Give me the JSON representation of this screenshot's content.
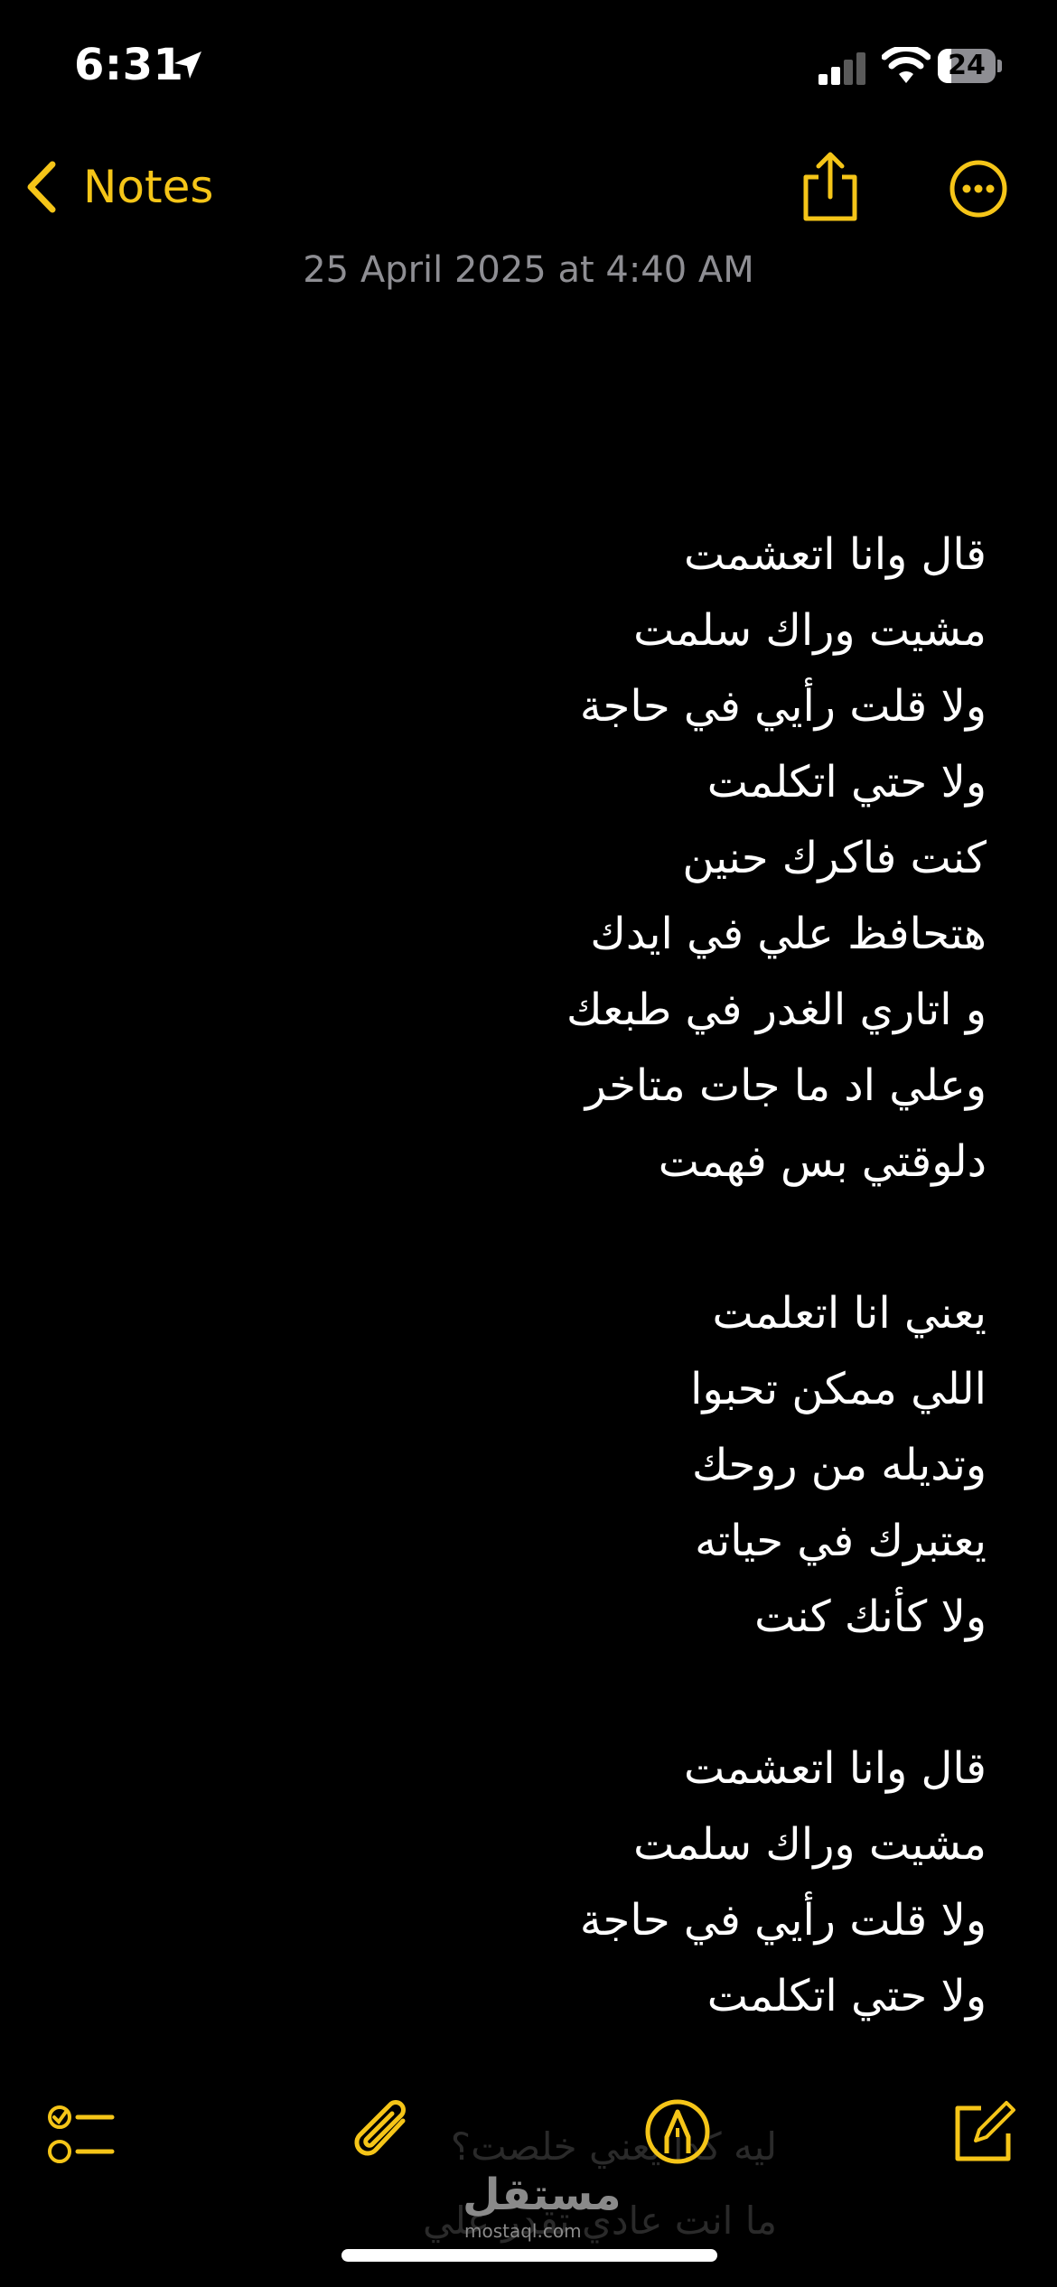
{
  "status_bar": {
    "time": "6:31",
    "battery": "24",
    "battery_level": 0.24
  },
  "nav": {
    "back_label": "Notes"
  },
  "note": {
    "date": "25 April 2025 at 4:40 AM",
    "lines": [
      "قال وانا اتعشمت",
      "مشيت وراك سلمت",
      "ولا قلت رأيي في حاجة",
      "ولا حتي اتكلمت",
      "كنت فاكرك حنين",
      "هتحافظ علي في ايدك",
      "و اتاري الغدر في طبعك",
      "وعلي اد ما جات متاخر",
      "دلوقتي بس فهمت",
      "",
      "يعني انا اتعلمت",
      "اللي ممكن تحبوا",
      "وتديله من روحك",
      "يعتبرك في حياته",
      "ولا كأنك كنت",
      "",
      "قال وانا اتعشمت",
      "مشيت وراك سلمت",
      "ولا قلت رأيي في حاجة",
      "ولا حتي اتكلمت"
    ],
    "overflow_lines": [
      "ليه كدا يعني خلصت؟",
      "ما انت عادي تقدر علي"
    ]
  },
  "watermark": {
    "arabic": "مستقل",
    "latin": "mostaql.com"
  },
  "colors": {
    "accent": "#f5c518",
    "background": "#000000",
    "secondary_text": "#8e8e93"
  },
  "icons": {
    "checklist": "checklist-icon",
    "attachment": "paperclip-icon",
    "markup": "pen-tip-icon",
    "compose": "compose-icon",
    "share": "share-icon",
    "more": "ellipsis-circle-icon"
  }
}
